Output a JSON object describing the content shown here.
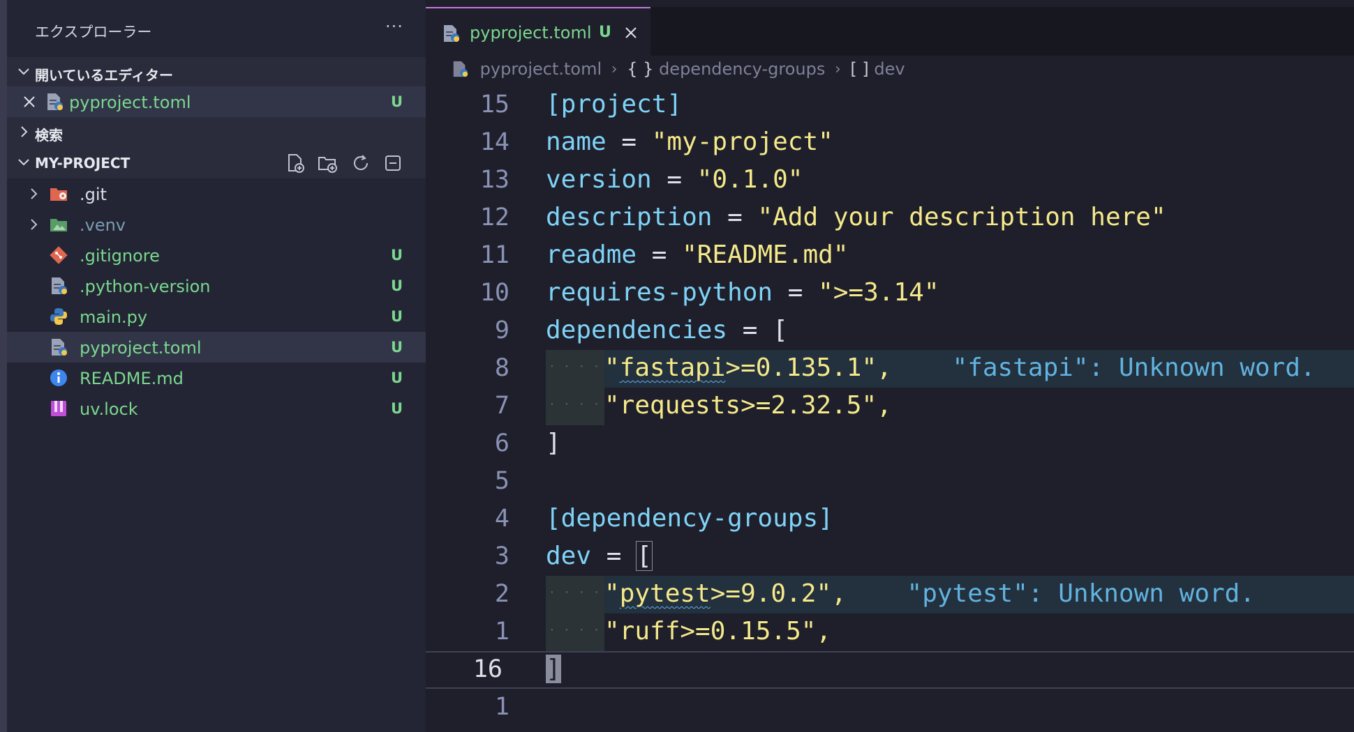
{
  "sidebar": {
    "title": "エクスプローラー",
    "more": "···",
    "open_editors": {
      "label": "開いているエディター",
      "items": [
        {
          "name": "pyproject.toml",
          "status": "U"
        }
      ]
    },
    "search": {
      "label": "検索"
    },
    "project": {
      "label": "MY-PROJECT",
      "tools": [
        "new-file-icon",
        "new-folder-icon",
        "refresh-icon",
        "collapse-all-icon"
      ],
      "items": [
        {
          "name": ".git",
          "status": "",
          "icon": "git-folder-icon"
        },
        {
          "name": ".venv",
          "status": "",
          "icon": "venv-folder-icon"
        },
        {
          "name": ".gitignore",
          "status": "U",
          "icon": "git-icon"
        },
        {
          "name": ".python-version",
          "status": "U",
          "icon": "python-config-icon"
        },
        {
          "name": "main.py",
          "status": "U",
          "icon": "python-icon"
        },
        {
          "name": "pyproject.toml",
          "status": "U",
          "icon": "toml-icon"
        },
        {
          "name": "README.md",
          "status": "U",
          "icon": "info-icon"
        },
        {
          "name": "uv.lock",
          "status": "U",
          "icon": "lock-icon"
        }
      ]
    }
  },
  "editor": {
    "tab": {
      "name": "pyproject.toml",
      "status": "U"
    },
    "breadcrumb": [
      "pyproject.toml",
      "dependency-groups",
      "dev"
    ],
    "breadcrumb_icons": [
      "{ }",
      "[ ]"
    ],
    "lines": {
      "l15": {
        "num": "15",
        "t1": "[project]"
      },
      "l14": {
        "num": "14",
        "k": "name",
        "eq": " = ",
        "s": "\"my-project\""
      },
      "l13": {
        "num": "13",
        "k": "version",
        "eq": " = ",
        "s": "\"0.1.0\""
      },
      "l12": {
        "num": "12",
        "k": "description",
        "eq": " = ",
        "s": "\"Add your description here\""
      },
      "l11": {
        "num": "11",
        "k": "readme",
        "eq": " = ",
        "s": "\"README.md\""
      },
      "l10": {
        "num": "10",
        "k": "requires-python",
        "eq": " = ",
        "s": "\">=3.14\""
      },
      "l9": {
        "num": "9",
        "k": "dependencies",
        "eq": " = ",
        "p": "["
      },
      "l8": {
        "num": "8",
        "q": "\"",
        "w": "fastapi",
        "rest": ">=0.135.1\",",
        "diag": "\"fastapi\": Unknown word."
      },
      "l7": {
        "num": "7",
        "s": "\"requests>=2.32.5\","
      },
      "l6": {
        "num": "6",
        "p": "]"
      },
      "l5": {
        "num": "5"
      },
      "l4": {
        "num": "4",
        "t1": "[dependency-groups]"
      },
      "l3": {
        "num": "3",
        "k": "dev",
        "eq": " = ",
        "p": "["
      },
      "l2": {
        "num": "2",
        "q": "\"",
        "w": "pytest",
        "rest": ">=9.0.2\",",
        "diag": "\"pytest\": Unknown word."
      },
      "l1": {
        "num": "1",
        "s": "\"ruff>=0.15.5\","
      },
      "cur": {
        "num": "16",
        "p": "]"
      },
      "n1": {
        "num": "1"
      }
    }
  },
  "colors": {
    "added": "#7bd88f",
    "keyword": "#7fd3f7",
    "string": "#f5e98a",
    "diagnostic": "#61b3e0"
  }
}
